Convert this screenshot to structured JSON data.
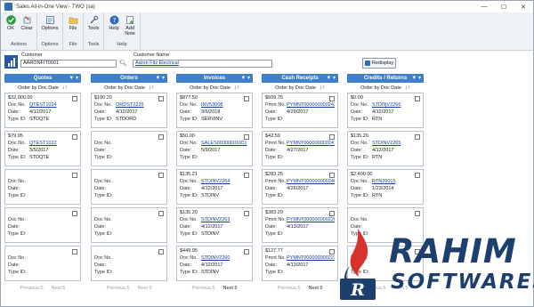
{
  "window": {
    "title": "Sales All-in-One View  -  TWO (sa)",
    "controls": [
      "—",
      "☐",
      "✕"
    ]
  },
  "ribbon": {
    "groups": [
      {
        "label": "Actions",
        "buttons": [
          {
            "label": "OK",
            "icon": "check-icon"
          },
          {
            "label": "Clear",
            "icon": "clear-icon"
          }
        ]
      },
      {
        "label": "Options",
        "buttons": [
          {
            "label": "Options",
            "icon": "options-icon"
          }
        ]
      },
      {
        "label": "File",
        "buttons": [
          {
            "label": "File",
            "icon": "folder-icon"
          }
        ]
      },
      {
        "label": "Tools",
        "buttons": [
          {
            "label": "Tools",
            "icon": "tools-icon"
          }
        ]
      },
      {
        "label": "Help",
        "buttons": [
          {
            "label": "Help",
            "icon": "help-icon"
          },
          {
            "label": "Add Note",
            "icon": "add-note-icon"
          }
        ]
      }
    ]
  },
  "customer": {
    "id_label": "Customer",
    "id_value": "AARONFIT0001",
    "name_label": "Customer Name",
    "name_value": "Aaron Fitz Electrical",
    "redisplay_label": "Redisplay"
  },
  "sort_label": "Order by Doc Date",
  "columns": [
    {
      "title": "Quotes",
      "cards": [
        {
          "amount": "$32,000.00",
          "fields": [
            {
              "k": "Doc No.",
              "v": "QTEST1024",
              "link": true
            },
            {
              "k": "Date:",
              "v": "4/12/2017"
            }
          ],
          "type": "STDQTE"
        },
        {
          "amount": "$79.95",
          "fields": [
            {
              "k": "Doc No.",
              "v": "QTEST1022",
              "link": true
            },
            {
              "k": "Date:",
              "v": "3/5/2017"
            }
          ],
          "type": "STDQTE"
        },
        {
          "amount": "",
          "fields": [
            {
              "k": "Doc No.",
              "v": ""
            },
            {
              "k": "Date:",
              "v": ""
            }
          ],
          "type": ""
        },
        {
          "amount": "",
          "fields": [
            {
              "k": "Doc No.",
              "v": ""
            },
            {
              "k": "Date:",
              "v": ""
            }
          ],
          "type": ""
        },
        {
          "amount": "",
          "fields": [
            {
              "k": "Doc No.",
              "v": ""
            },
            {
              "k": "Date:",
              "v": ""
            }
          ],
          "type": ""
        }
      ],
      "pager": {
        "prev": "Previous 5",
        "next": "Next 5",
        "next_enabled": false
      }
    },
    {
      "title": "Orders",
      "cards": [
        {
          "amount": "$100.20",
          "fields": [
            {
              "k": "Doc No.",
              "v": "ORDST2226",
              "link": true
            },
            {
              "k": "Date:",
              "v": "4/12/2017"
            }
          ],
          "type": "STDORD"
        },
        {
          "amount": "",
          "fields": [
            {
              "k": "Doc No.",
              "v": ""
            },
            {
              "k": "Date:",
              "v": ""
            }
          ],
          "type": ""
        },
        {
          "amount": "",
          "fields": [
            {
              "k": "Doc No.",
              "v": ""
            },
            {
              "k": "Date:",
              "v": ""
            }
          ],
          "type": ""
        },
        {
          "amount": "",
          "fields": [
            {
              "k": "Doc No.",
              "v": ""
            },
            {
              "k": "Date:",
              "v": ""
            }
          ],
          "type": ""
        },
        {
          "amount": "",
          "fields": [
            {
              "k": "Doc No.",
              "v": ""
            },
            {
              "k": "Date:",
              "v": ""
            }
          ],
          "type": ""
        }
      ],
      "pager": {
        "prev": "Previous 5",
        "next": "Next 5",
        "next_enabled": false
      }
    },
    {
      "title": "Invoices",
      "cards": [
        {
          "amount": "$877.50",
          "fields": [
            {
              "k": "Doc No.",
              "v": "INV53008",
              "link": true
            },
            {
              "k": "Date:",
              "v": "3/6/2018"
            }
          ],
          "type": "SERVINV"
        },
        {
          "amount": "$50.00",
          "fields": [
            {
              "k": "Doc No.",
              "v": "SALES00000001001",
              "link": true
            },
            {
              "k": "Date:",
              "v": "5/9/2017"
            }
          ],
          "type": ""
        },
        {
          "amount": "$135.21",
          "fields": [
            {
              "k": "Doc No.",
              "v": "STDINV2264",
              "link": true
            },
            {
              "k": "Date:",
              "v": "4/12/2017"
            }
          ],
          "type": "STDINV"
        },
        {
          "amount": "$135.20",
          "fields": [
            {
              "k": "Doc No.",
              "v": "STDINV2263",
              "link": true
            },
            {
              "k": "Date:",
              "v": "4/12/2017"
            }
          ],
          "type": "STDINV"
        },
        {
          "amount": "$449.95",
          "fields": [
            {
              "k": "Doc No.",
              "v": "STDINV2260",
              "link": true
            },
            {
              "k": "Date:",
              "v": "4/12/2017"
            }
          ],
          "type": "STDINV"
        }
      ],
      "pager": {
        "prev": "Previous 5",
        "next": "Next 5",
        "next_enabled": true
      }
    },
    {
      "title": "Cash Receipts",
      "cards": [
        {
          "amount": "$609.75",
          "fields": [
            {
              "k": "Pmnt No.",
              "v": "PYMNT000000000243",
              "link": true
            },
            {
              "k": "Date:",
              "v": "4/29/2017"
            }
          ],
          "type": ""
        },
        {
          "amount": "$42.59",
          "fields": [
            {
              "k": "Pmnt No.",
              "v": "PYMNT000000000241",
              "link": true
            },
            {
              "k": "Date:",
              "v": "4/27/2017"
            }
          ],
          "type": ""
        },
        {
          "amount": "$283.25",
          "fields": [
            {
              "k": "Pmnt No.",
              "v": "PYMNT000000000240",
              "link": true
            },
            {
              "k": "Date:",
              "v": "4/26/2017"
            }
          ],
          "type": ""
        },
        {
          "amount": "$383.29",
          "fields": [
            {
              "k": "Pmnt No.",
              "v": "PYMNT000000000226",
              "link": true
            },
            {
              "k": "Date:",
              "v": "4/13/2017"
            }
          ],
          "type": ""
        },
        {
          "amount": "$127.77",
          "fields": [
            {
              "k": "Pmnt No.",
              "v": "PYMNT000000000223",
              "link": true
            },
            {
              "k": "Date:",
              "v": "4/13/2017"
            }
          ],
          "type": ""
        }
      ],
      "pager": {
        "prev": "Previous 5",
        "next": "Next 5",
        "next_enabled": true
      }
    },
    {
      "title": "Credits / Returns",
      "cards": [
        {
          "amount": "$0.00",
          "fields": [
            {
              "k": "Doc No.",
              "v": "STDINV2266",
              "link": true
            },
            {
              "k": "Date:",
              "v": "4/12/2017"
            }
          ],
          "type": "RTN"
        },
        {
          "amount": "$135.20",
          "fields": [
            {
              "k": "Doc No.",
              "v": "STDINV2265",
              "link": true
            },
            {
              "k": "Date:",
              "v": "4/12/2017"
            }
          ],
          "type": "RTN"
        },
        {
          "amount": "$2,400.00",
          "fields": [
            {
              "k": "Doc No.",
              "v": "RTN20015",
              "link": true
            },
            {
              "k": "Date:",
              "v": "1/23/2014"
            }
          ],
          "type": "RTN"
        },
        {
          "amount": "",
          "fields": [
            {
              "k": "Doc No.",
              "v": ""
            },
            {
              "k": "Date:",
              "v": ""
            }
          ],
          "type": ""
        },
        {
          "amount": "",
          "fields": [
            {
              "k": "Doc No.",
              "v": ""
            },
            {
              "k": "Date:",
              "v": ""
            }
          ],
          "type": ""
        }
      ],
      "pager": {
        "prev": "Previous 5",
        "next": "Next 5",
        "next_enabled": false
      }
    }
  ],
  "watermark": {
    "line1": "RAHIM",
    "line2": "SOFTWARES"
  },
  "colors": {
    "accent": "#3f7fcc",
    "link": "#1340a8",
    "watermark": "#1d3f6e"
  }
}
